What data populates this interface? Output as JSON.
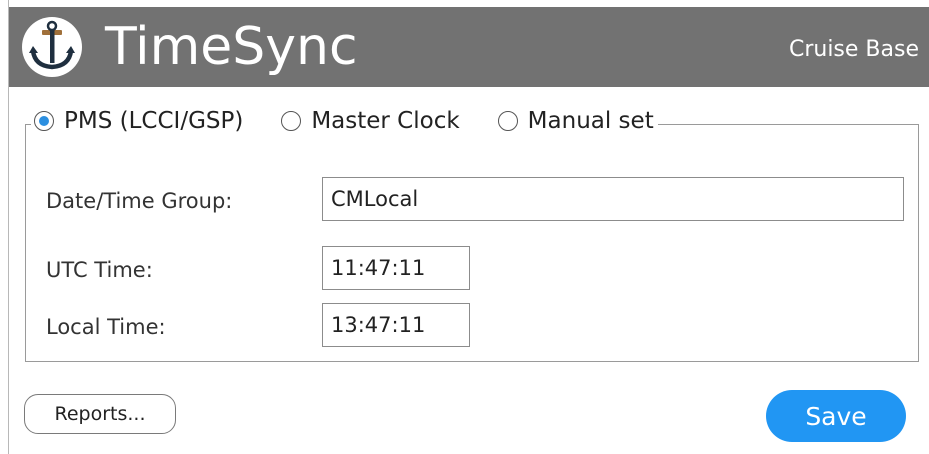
{
  "header": {
    "title": "TimeSync",
    "base_label": "Cruise Base",
    "logo_icon": "anchor-icon",
    "background_color": "#727272"
  },
  "source_selection": {
    "options": [
      {
        "label": "PMS (LCCI/GSP)",
        "checked": true
      },
      {
        "label": "Master Clock",
        "checked": false
      },
      {
        "label": "Manual set",
        "checked": false
      }
    ]
  },
  "fields": {
    "date_time_group": {
      "label": "Date/Time Group:",
      "value": "CMLocal"
    },
    "utc_time": {
      "label": "UTC Time:",
      "value": "11:47:11"
    },
    "local_time": {
      "label": "Local Time:",
      "value": "13:47:11"
    }
  },
  "actions": {
    "reports_label": "Reports...",
    "save_label": "Save",
    "save_color": "#2196f3"
  },
  "colors": {
    "radio_selected": "#2c8fe0",
    "text": "#222222"
  }
}
